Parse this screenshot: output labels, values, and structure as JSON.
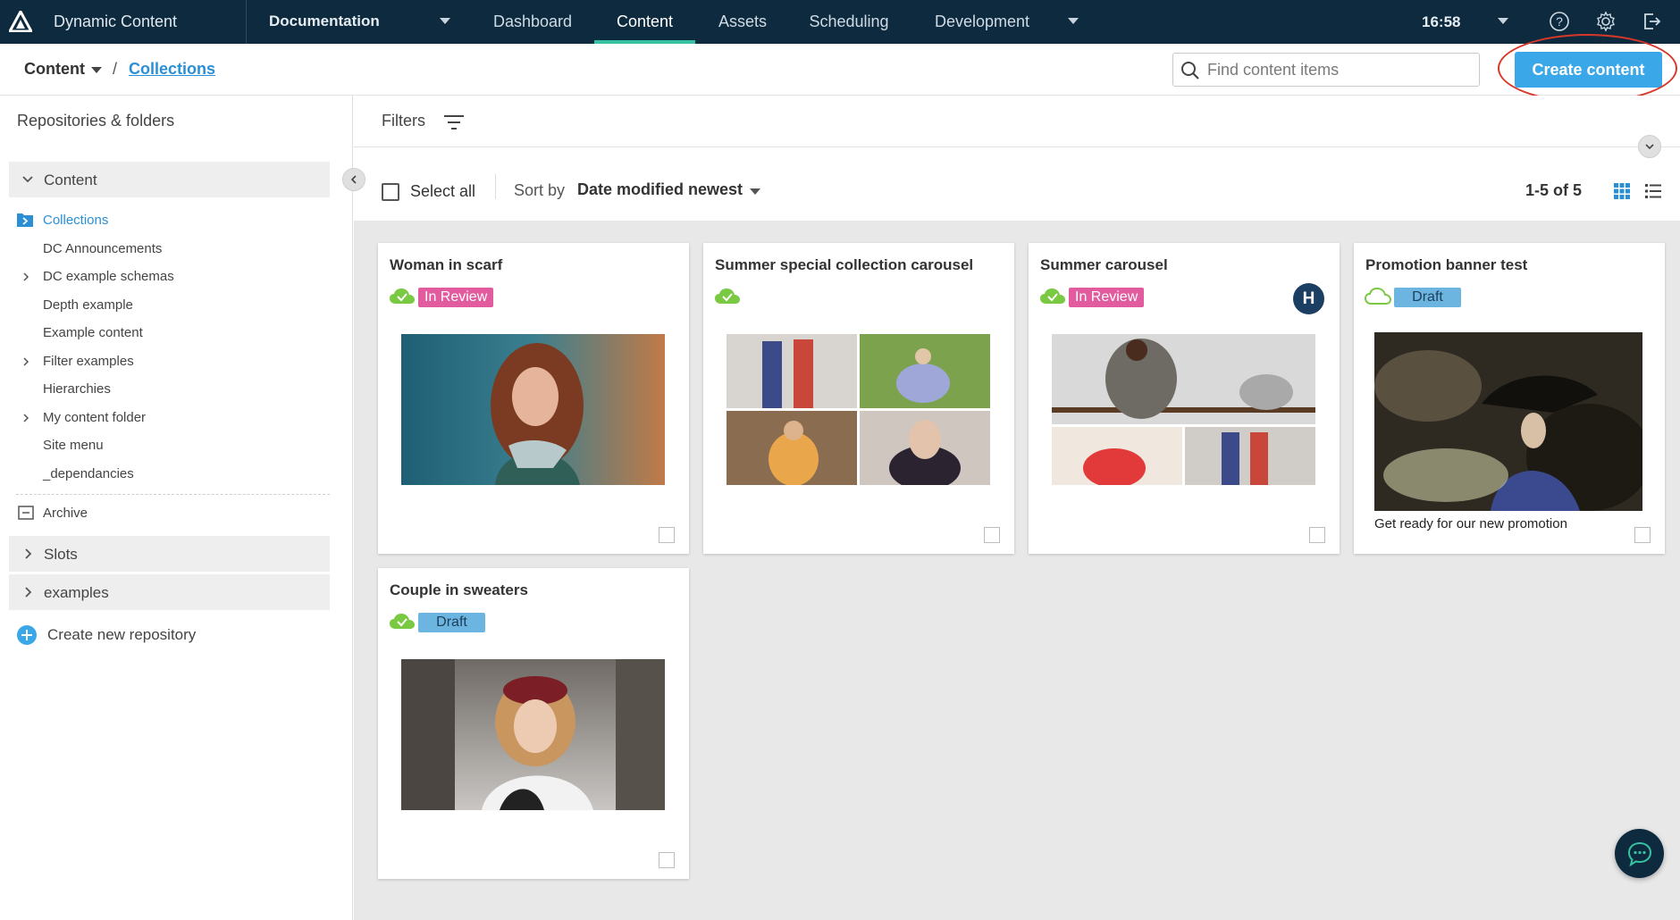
{
  "app": {
    "title": "Dynamic Content"
  },
  "topnav": {
    "hub": "Documentation",
    "tabs": [
      {
        "label": "Dashboard",
        "active": false
      },
      {
        "label": "Content",
        "active": true
      },
      {
        "label": "Assets",
        "active": false
      },
      {
        "label": "Scheduling",
        "active": false
      },
      {
        "label": "Development",
        "active": false
      }
    ],
    "time": "16:58"
  },
  "breadcrumb": {
    "root": "Content",
    "separator": "/",
    "current": "Collections"
  },
  "search": {
    "placeholder": "Find content items",
    "value": ""
  },
  "create_button": {
    "label": "Create content"
  },
  "sidebar": {
    "title": "Repositories & folders",
    "repo_content": "Content",
    "folders": [
      "Collections",
      "DC Announcements",
      "DC example schemas",
      "Depth example",
      "Example content",
      "Filter examples",
      "Hierarchies",
      "My content folder",
      "Site menu",
      "_dependancies"
    ],
    "archive": "Archive",
    "repo_slots": "Slots",
    "repo_examples": "examples",
    "create_repo": "Create new repository"
  },
  "filters": {
    "label": "Filters"
  },
  "toolbar": {
    "select_all": "Select all",
    "sort_by_label": "Sort by",
    "sort_value": "Date modified newest",
    "pager": "1-5 of 5"
  },
  "cards": [
    {
      "title": "Woman in scarf",
      "status": "In Review",
      "synced": true
    },
    {
      "title": "Summer special collection carousel",
      "status": "",
      "synced": true
    },
    {
      "title": "Summer carousel",
      "status": "In Review",
      "synced": true,
      "assignee": "H"
    },
    {
      "title": "Promotion banner test",
      "status": "Draft",
      "synced": false,
      "caption": "Get ready for our new promotion"
    },
    {
      "title": "Couple in sweaters",
      "status": "Draft",
      "synced": true
    }
  ],
  "colors": {
    "nav_bg": "#0e2a3f",
    "accent": "#36c3a3",
    "primary": "#3aa7e8",
    "review": "#e25b9f",
    "draft": "#6bb5e0",
    "link": "#2b8fd6",
    "synced": "#7ac943"
  },
  "icons": [
    "amplience-logo-icon",
    "help-icon",
    "gear-icon",
    "logout-icon",
    "search-icon",
    "filter-icon",
    "grid-view-icon",
    "list-view-icon",
    "chat-icon",
    "cloud-check-icon",
    "cloud-icon",
    "folder-icon",
    "archive-icon",
    "plus-circle-icon"
  ]
}
